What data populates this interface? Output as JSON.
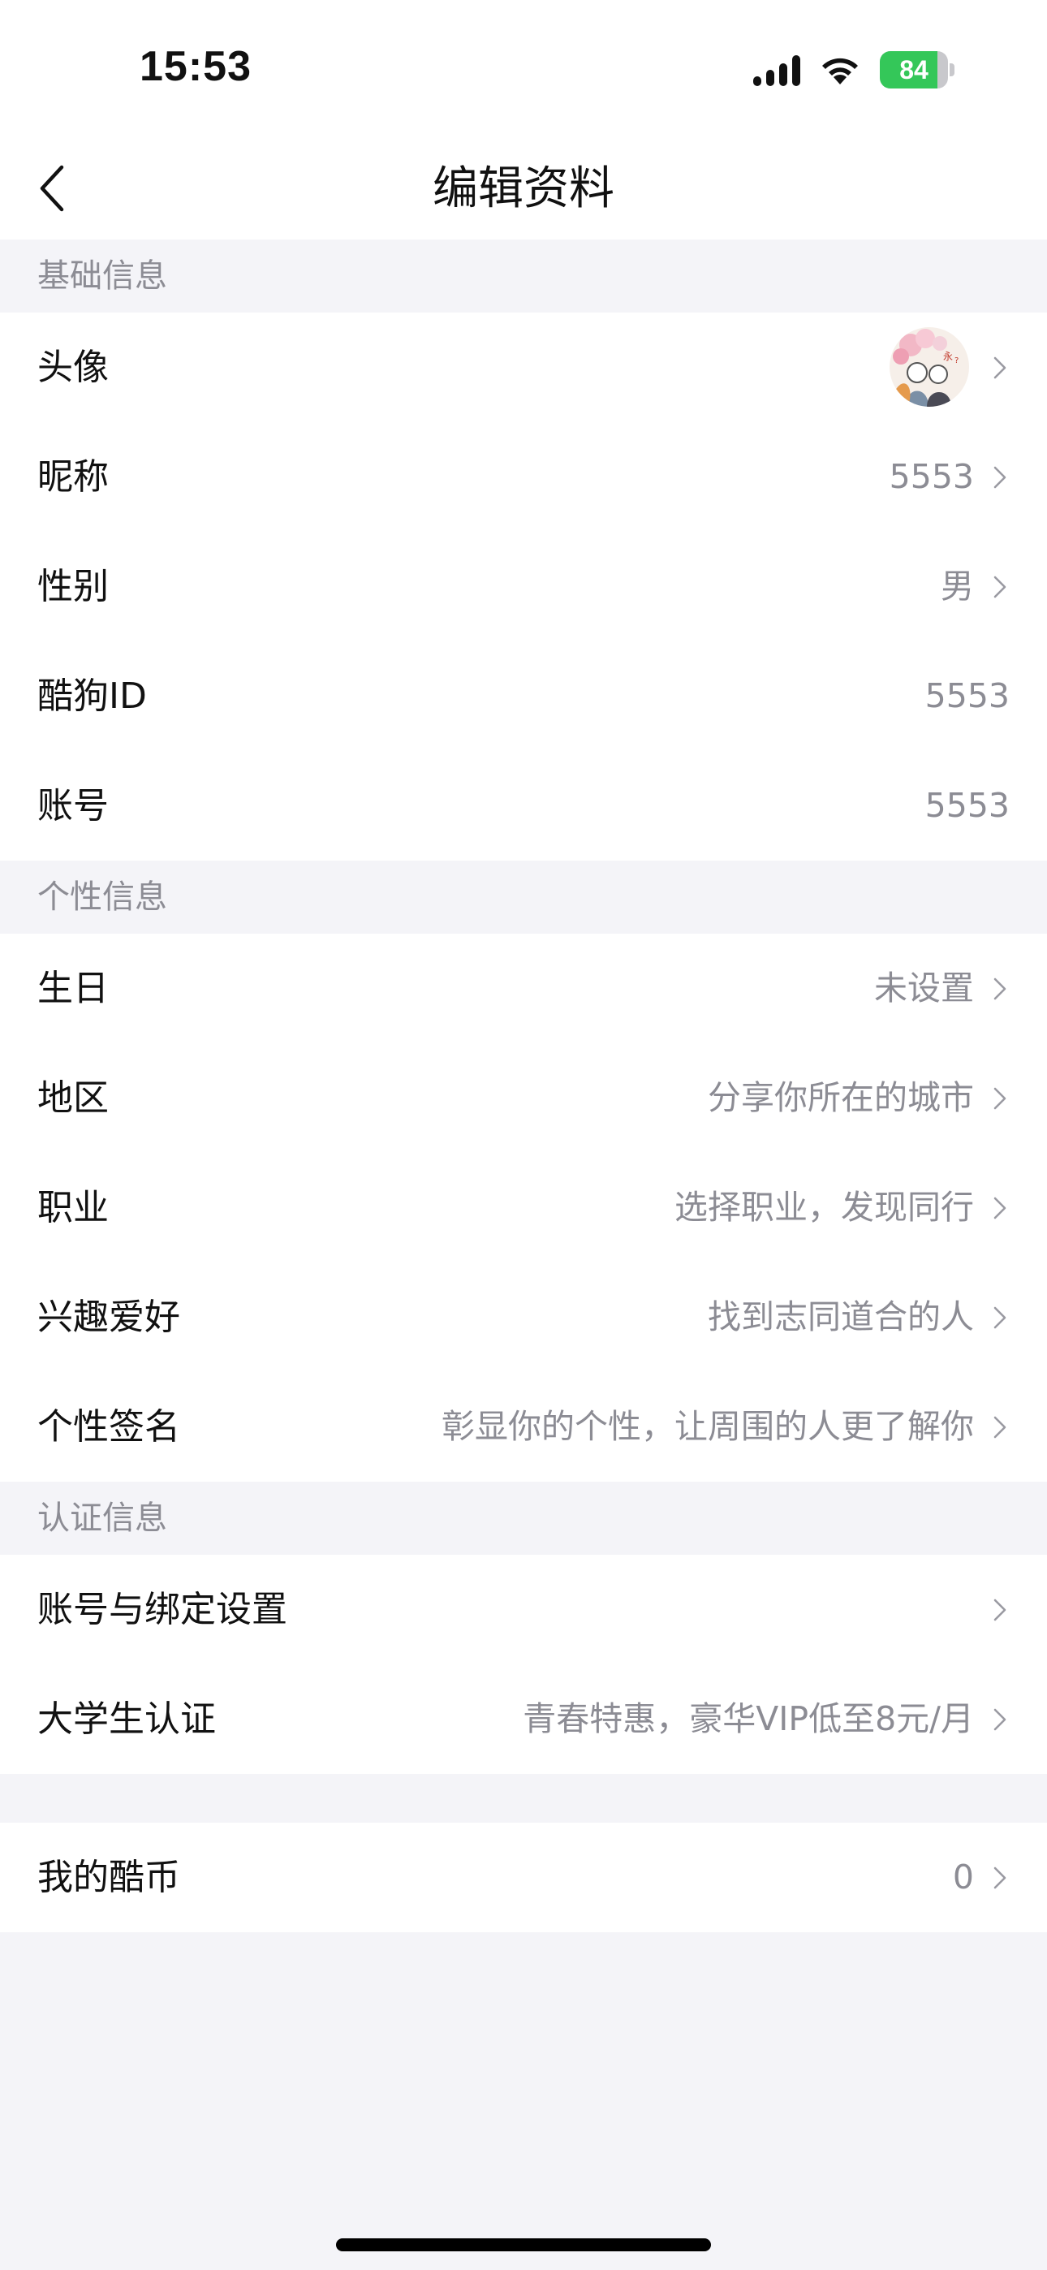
{
  "status_bar": {
    "time": "15:53",
    "battery": "84",
    "battery_level_percent": 84,
    "battery_color": "#34c759"
  },
  "header": {
    "title": "编辑资料",
    "back_icon": "chevron-left-icon"
  },
  "sections": [
    {
      "title": "基础信息",
      "rows": [
        {
          "label": "头像",
          "value": "",
          "type": "avatar",
          "arrow": true
        },
        {
          "label": "昵称",
          "value": "5553",
          "arrow": true
        },
        {
          "label": "性别",
          "value": "男",
          "arrow": true
        },
        {
          "label": "酷狗ID",
          "value": "5553",
          "arrow": false
        },
        {
          "label": "账号",
          "value": "5553",
          "arrow": false
        }
      ]
    },
    {
      "title": "个性信息",
      "rows": [
        {
          "label": "生日",
          "value": "未设置",
          "arrow": true
        },
        {
          "label": "地区",
          "value": "分享你所在的城市",
          "arrow": true
        },
        {
          "label": "职业",
          "value": "选择职业，发现同行",
          "arrow": true
        },
        {
          "label": "兴趣爱好",
          "value": "找到志同道合的人",
          "arrow": true
        },
        {
          "label": "个性签名",
          "value": "彰显你的个性，让周围的人更了解你",
          "arrow": true
        }
      ]
    },
    {
      "title": "认证信息",
      "rows": [
        {
          "label": "账号与绑定设置",
          "value": "",
          "arrow": true
        },
        {
          "label": "大学生认证",
          "value": "青春特惠，豪华VIP低至8元/月",
          "arrow": true
        }
      ]
    }
  ],
  "extra_group": {
    "rows": [
      {
        "label": "我的酷币",
        "value": "0",
        "arrow": true
      }
    ]
  }
}
